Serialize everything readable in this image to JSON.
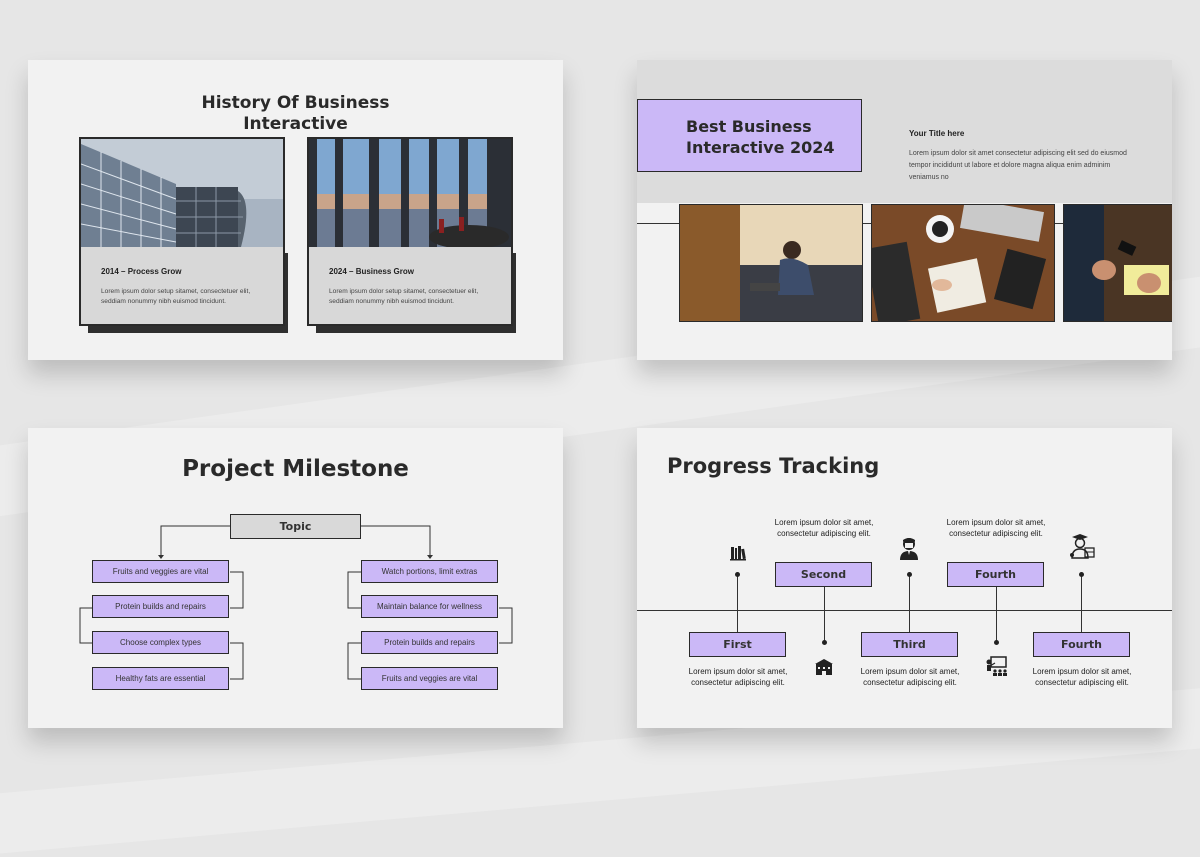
{
  "slides": {
    "history": {
      "title": "History Of Business Interactive",
      "cards": [
        {
          "heading": "2014 – Process Grow",
          "text": "Lorem ipsum dolor setup sitamet, consectetuer elit, seddiam nonummy nibh euismod tincidunt."
        },
        {
          "heading": "2024 – Business Grow",
          "text": "Lorem ipsum dolor setup sitamet, consectetuer elit, seddiam nonummy nibh euismod tincidunt."
        }
      ]
    },
    "best": {
      "title": "Best Business Interactive 2024",
      "subtitle": "Your Title here",
      "text": "Lorem ipsum dolor sit amet consectetur adipiscing elit sed do eiusmod tempor incididunt ut labore et dolore magna aliqua enim adminim veniamus no"
    },
    "milestone": {
      "title": "Project Milestone",
      "topic": "Topic",
      "left": [
        "Fruits and veggies are vital",
        "Protein builds and repairs",
        "Choose complex types",
        "Healthy fats are essential"
      ],
      "right": [
        "Watch portions, limit extras",
        "Maintain balance for wellness",
        "Protein builds and repairs",
        "Fruits and veggies are vital"
      ]
    },
    "progress": {
      "title": "Progress Tracking",
      "steps": [
        {
          "label": "First",
          "text": "Lorem ipsum dolor sit amet, consectetur adipiscing elit."
        },
        {
          "label": "Second",
          "text": "Lorem ipsum dolor sit amet, consectetur adipiscing elit."
        },
        {
          "label": "Third",
          "text": "Lorem ipsum dolor sit amet, consectetur adipiscing elit."
        },
        {
          "label": "Fourth",
          "text": "Lorem ipsum dolor sit amet, consectetur adipiscing elit."
        },
        {
          "label": "Fourth",
          "text": "Lorem ipsum dolor sit amet, consectetur adipiscing elit."
        }
      ]
    }
  },
  "colors": {
    "accent": "#cbb8f7",
    "dark": "#2a2a2a",
    "slide_bg": "#f2f2f2",
    "page_bg": "#e6e6e6"
  },
  "icons": [
    "books-icon",
    "school-icon",
    "student-icon",
    "teacher-icon",
    "graduate-icon"
  ]
}
